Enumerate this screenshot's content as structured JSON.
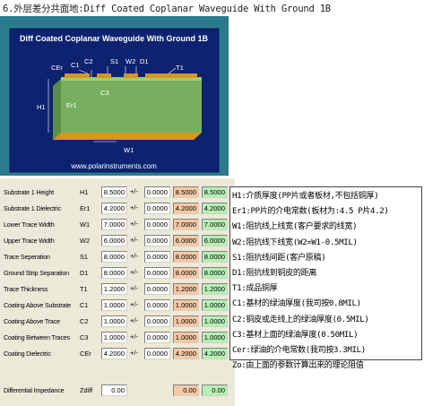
{
  "page_title": "6.外层差分共面地:Diff Coated Coplanar Waveguide With Ground 1B",
  "diagram": {
    "title": "Diff Coated Coplanar Waveguide With Ground 1B",
    "labels": {
      "cer": "CEr",
      "c1": "C1",
      "c2": "C2",
      "s1": "S1",
      "w2": "W2",
      "d1": "D1",
      "t1": "T1",
      "c3": "C3",
      "h1": "H1",
      "er1": "Er1",
      "w1": "W1"
    },
    "url": "www.polarinstruments.com",
    "colors": {
      "frame": "#2a7c8c",
      "substrate": "#78ae60",
      "copper": "#d8961e",
      "background": "#0d2370"
    }
  },
  "params": [
    {
      "label": "Substrate 1 Height",
      "sym": "H1",
      "value": "8.5000",
      "tol": "0.0000",
      "min": "8.5000",
      "max": "8.5000"
    },
    {
      "label": "Substrate 1 Dielectric",
      "sym": "Er1",
      "value": "4.2000",
      "tol": "0.0000",
      "min": "4.2000",
      "max": "4.2000"
    },
    {
      "label": "Lower Trace Width",
      "sym": "W1",
      "value": "7.0000",
      "tol": "0.0000",
      "min": "7.0000",
      "max": "7.0000"
    },
    {
      "label": "Upper Trace Width",
      "sym": "W2",
      "value": "6.0000",
      "tol": "0.0000",
      "min": "6.0000",
      "max": "6.0000"
    },
    {
      "label": "Trace Seperation",
      "sym": "S1",
      "value": "8.0000",
      "tol": "0.0000",
      "min": "8.0000",
      "max": "8.0000"
    },
    {
      "label": "Ground Strip Separation",
      "sym": "D1",
      "value": "8.0000",
      "tol": "0.0000",
      "min": "8.0000",
      "max": "8.0000"
    },
    {
      "label": "Trace Thickness",
      "sym": "T1",
      "value": "1.2000",
      "tol": "0.0000",
      "min": "1.2000",
      "max": "1.2000"
    },
    {
      "label": "Coating Above Substrate",
      "sym": "C1",
      "value": "1.0000",
      "tol": "0.0000",
      "min": "1.0000",
      "max": "1.0000"
    },
    {
      "label": "Coating Above Trace",
      "sym": "C2",
      "value": "1.0000",
      "tol": "0.0000",
      "min": "1.0000",
      "max": "1.0000"
    },
    {
      "label": "Coating Between Traces",
      "sym": "C3",
      "value": "1.0000",
      "tol": "0.0000",
      "min": "1.0000",
      "max": "1.0000"
    },
    {
      "label": "Coating Dielectric",
      "sym": "CEr",
      "value": "4.2000",
      "tol": "0.0000",
      "min": "4.2000",
      "max": "4.2000"
    }
  ],
  "pm_symbol": "+/-",
  "impedance": {
    "label": "Differential Impedance",
    "sym": "Zdiff",
    "value": "0.00",
    "min": "0.00",
    "max": "0.00"
  },
  "notes": [
    "H1:介质厚度(PP片或者板材,不包括铜厚)",
    "Er1:PP片的介电常数(板材为:4.5 P片4.2)",
    "W1:阻抗线上线宽(客户要求的线宽)",
    "W2:阻抗线下线宽(W2=W1-0.5MIL)",
    "S1:阻抗线间距(客户原稿)",
    "D1:阻抗线到铜皮的距离",
    "T1:成品铜厚",
    "C1:基材的绿油厚度(我司按0.8MIL)",
    "C2:铜皮或走线上的绿油厚度(0.5MIL)",
    "C3:基材上面的绿油厚度(0.50MIL)",
    "Cer:绿油的介电常数(我司按3.3MIL)",
    "Zo:由上面的参数计算出来的理论阻值"
  ]
}
